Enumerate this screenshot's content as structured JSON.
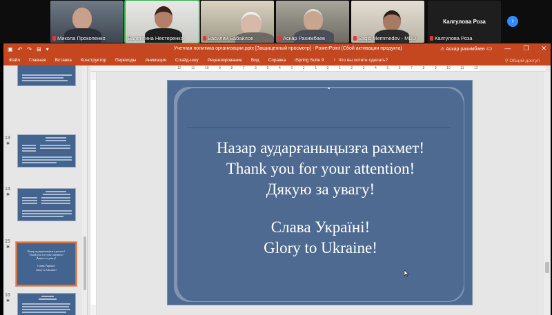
{
  "meeting": {
    "participants": [
      {
        "name": "Микола Прокопенко",
        "muted": true
      },
      {
        "name": "Валентина Нестеренко",
        "muted": false,
        "active": true
      },
      {
        "name": "Василий Бабайлов",
        "muted": true
      },
      {
        "name": "Аскар Рахимбаев",
        "muted": true
      },
      {
        "name": "Saqib Memmedov - MDU",
        "muted": true
      },
      {
        "name": "Калгулова Роза",
        "muted": true,
        "video_off": true
      }
    ],
    "next_icon": "chevron-right-icon"
  },
  "window": {
    "title": "Учетная политика организации.pptx [Защищенный просмотр] - PowerPoint (Сбой активации продукта)",
    "user": "Аскар рахимбаев",
    "accent": "#c4471f"
  },
  "ribbon": {
    "tabs": [
      "Файл",
      "Главная",
      "Вставка",
      "Конструктор",
      "Переходы",
      "Анимация",
      "Слайд-шоу",
      "Рецензирование",
      "Вид",
      "Справка",
      "iSpring Suite 9"
    ],
    "tell_me": "Что вы хотите сделать?",
    "share": "Общий доступ"
  },
  "ruler": {
    "marks": [
      "12",
      "11",
      "10",
      "9",
      "8",
      "7",
      "6",
      "5",
      "4",
      "3",
      "2",
      "1",
      "0",
      "1",
      "2",
      "3",
      "4",
      "5",
      "6",
      "7",
      "8",
      "9",
      "10",
      "11",
      "12"
    ]
  },
  "thumbnails": [
    {
      "number": "",
      "star": ""
    },
    {
      "number": "13",
      "star": "✱"
    },
    {
      "number": "14",
      "star": "✱"
    },
    {
      "number": "15",
      "star": "✱",
      "selected": true,
      "lines": [
        "Назар аударғаныңызға рахмет!",
        "Thank you for your attention!",
        "Дякую за увагу!",
        "",
        "Слава Україні!",
        "Glory to Ukraine!"
      ]
    },
    {
      "number": "16",
      "star": "✱"
    }
  ],
  "slide": {
    "lines": [
      "Назар аударғаныңызға рахмет!",
      "Thank you for your attention!",
      "Дякую за увагу!",
      "",
      "Слава Україні!",
      "Glory to Ukraine!"
    ]
  }
}
